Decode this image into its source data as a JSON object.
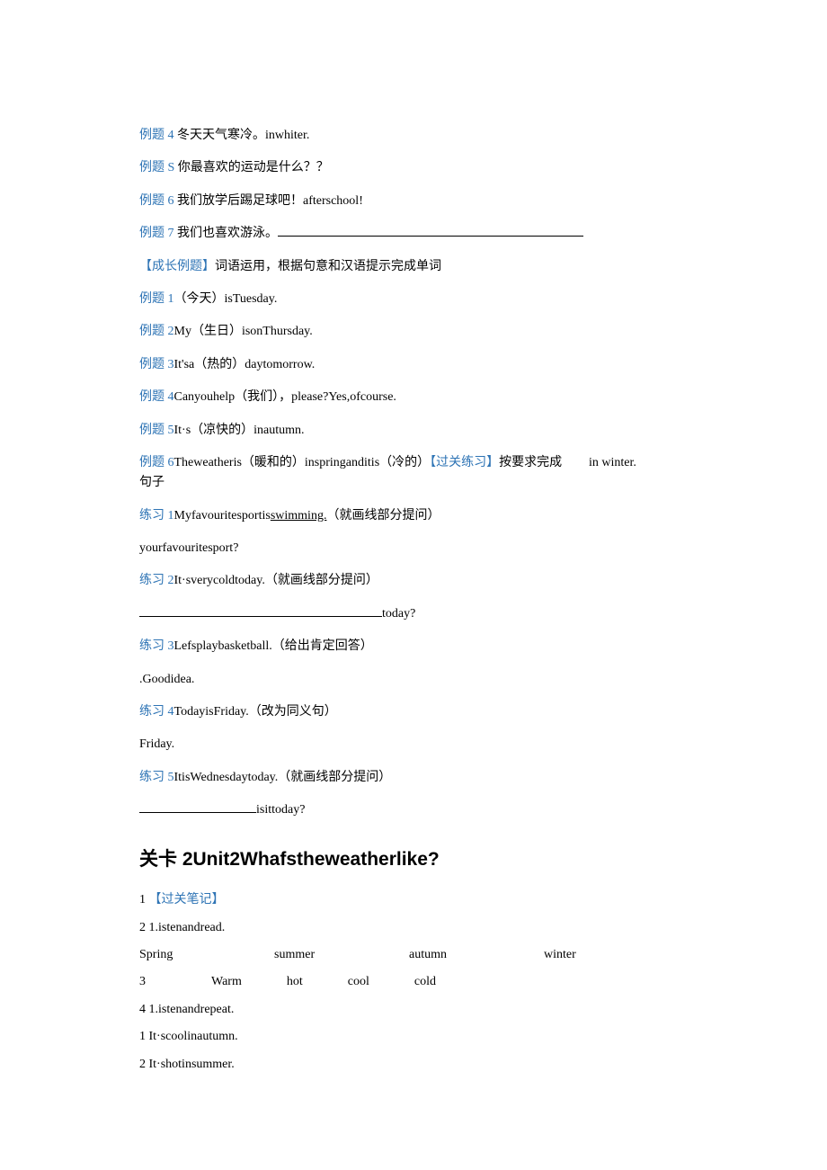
{
  "q1": {
    "ex4": {
      "label": "例题 4 ",
      "zh": "冬天天气寒冷。",
      "en": "inwhiter."
    },
    "exS": {
      "label": "例题 S ",
      "zh": "你最喜欢的运动是什么？？"
    },
    "ex6": {
      "label": "例题 6 ",
      "zh": "我们放学后踢足球吧！",
      "en": "afterschool!"
    },
    "ex7": {
      "label": "例题 7 ",
      "zh": "我们也喜欢游泳。"
    }
  },
  "growth": {
    "title": "【成长例题】",
    "desc": "词语运用，根据句意和汉语提示完成单词",
    "ex1": {
      "label": "例题 1",
      "zh": "（今天）",
      "en": "isTuesday."
    },
    "ex2": {
      "label": "例题 2",
      "pre": "My",
      "zh": "（生日）",
      "en": "isonThursday."
    },
    "ex3": {
      "label": "例题 3",
      "pre": "It'sa",
      "zh": "（热的）",
      "en": "daytomorrow."
    },
    "ex4": {
      "label": "例题 4",
      "pre": "Canyouhelp",
      "zh": "（我们）",
      "en": "，please?Yes,ofcourse."
    },
    "ex5": {
      "label": "例题 5",
      "pre": "It·s",
      "zh": "（凉快的）",
      "en": "inautumn."
    },
    "ex6": {
      "label": "例题 6",
      "pre": "Theweatheris",
      "zh1": "（暖和的）",
      "mid": "inspringanditis",
      "zh2": "（冷的）",
      "tail": "in winter."
    },
    "passTitle": "【过关练习】",
    "passDesc": "按要求完成",
    "sentenceWord": "句子"
  },
  "practice": {
    "p1": {
      "label": "练习 1",
      "pre": "Myfavouritesportis",
      "u": "swimming.",
      "note": "（就画线部分提问）",
      "ans": "yourfavouritesport?"
    },
    "p2": {
      "label": "练习 2",
      "text": "It·sverycoldtoday.",
      "note": "（就画线部分提问）",
      "ans": "today?"
    },
    "p3": {
      "label": "练习 3",
      "text": "Lefsplaybasketball.",
      "note": "（给出肯定回答）",
      "ans": ".Goodidea."
    },
    "p4": {
      "label": "练习 4",
      "text": "TodayisFriday.",
      "note": "（改为同义句）",
      "ans": "Friday."
    },
    "p5": {
      "label": "练习 5",
      "text": "ItisWednesdaytoday.",
      "note": "（就画线部分提问）",
      "ans": "isittoday?"
    }
  },
  "section2": {
    "title": "关卡 2Unit2Whafstheweatherlike?",
    "n1": {
      "num": "1 ",
      "label": "【过关笔记】"
    },
    "n2": {
      "num": "2 ",
      "text": "1.istenandread."
    },
    "seasons": {
      "s1": "Spring",
      "s2": "summer",
      "s3": "autumn",
      "s4": "winter"
    },
    "temps": {
      "num": "3",
      "t1": "Warm",
      "t2": "hot",
      "t3": "cool",
      "t4": "cold"
    },
    "n4": {
      "num": "4 ",
      "text": "1.istenandrepeat."
    },
    "l1": {
      "num": "1 ",
      "text": "It·scoolinautumn."
    },
    "l2": {
      "num": "2 ",
      "text": "It·shotinsummer."
    }
  }
}
